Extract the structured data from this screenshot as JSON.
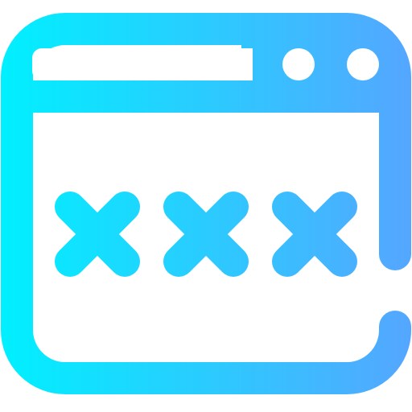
{
  "icon": {
    "name": "browser-password-icon",
    "gradient": {
      "start": "#00F0FF",
      "end": "#55A6FF"
    },
    "background": "#FFFFFF",
    "title_bar_buttons": [
      "window-dot-icon",
      "window-dot-icon"
    ],
    "password_mask_count": 3,
    "password_mask_glyph": "cross-icon"
  }
}
